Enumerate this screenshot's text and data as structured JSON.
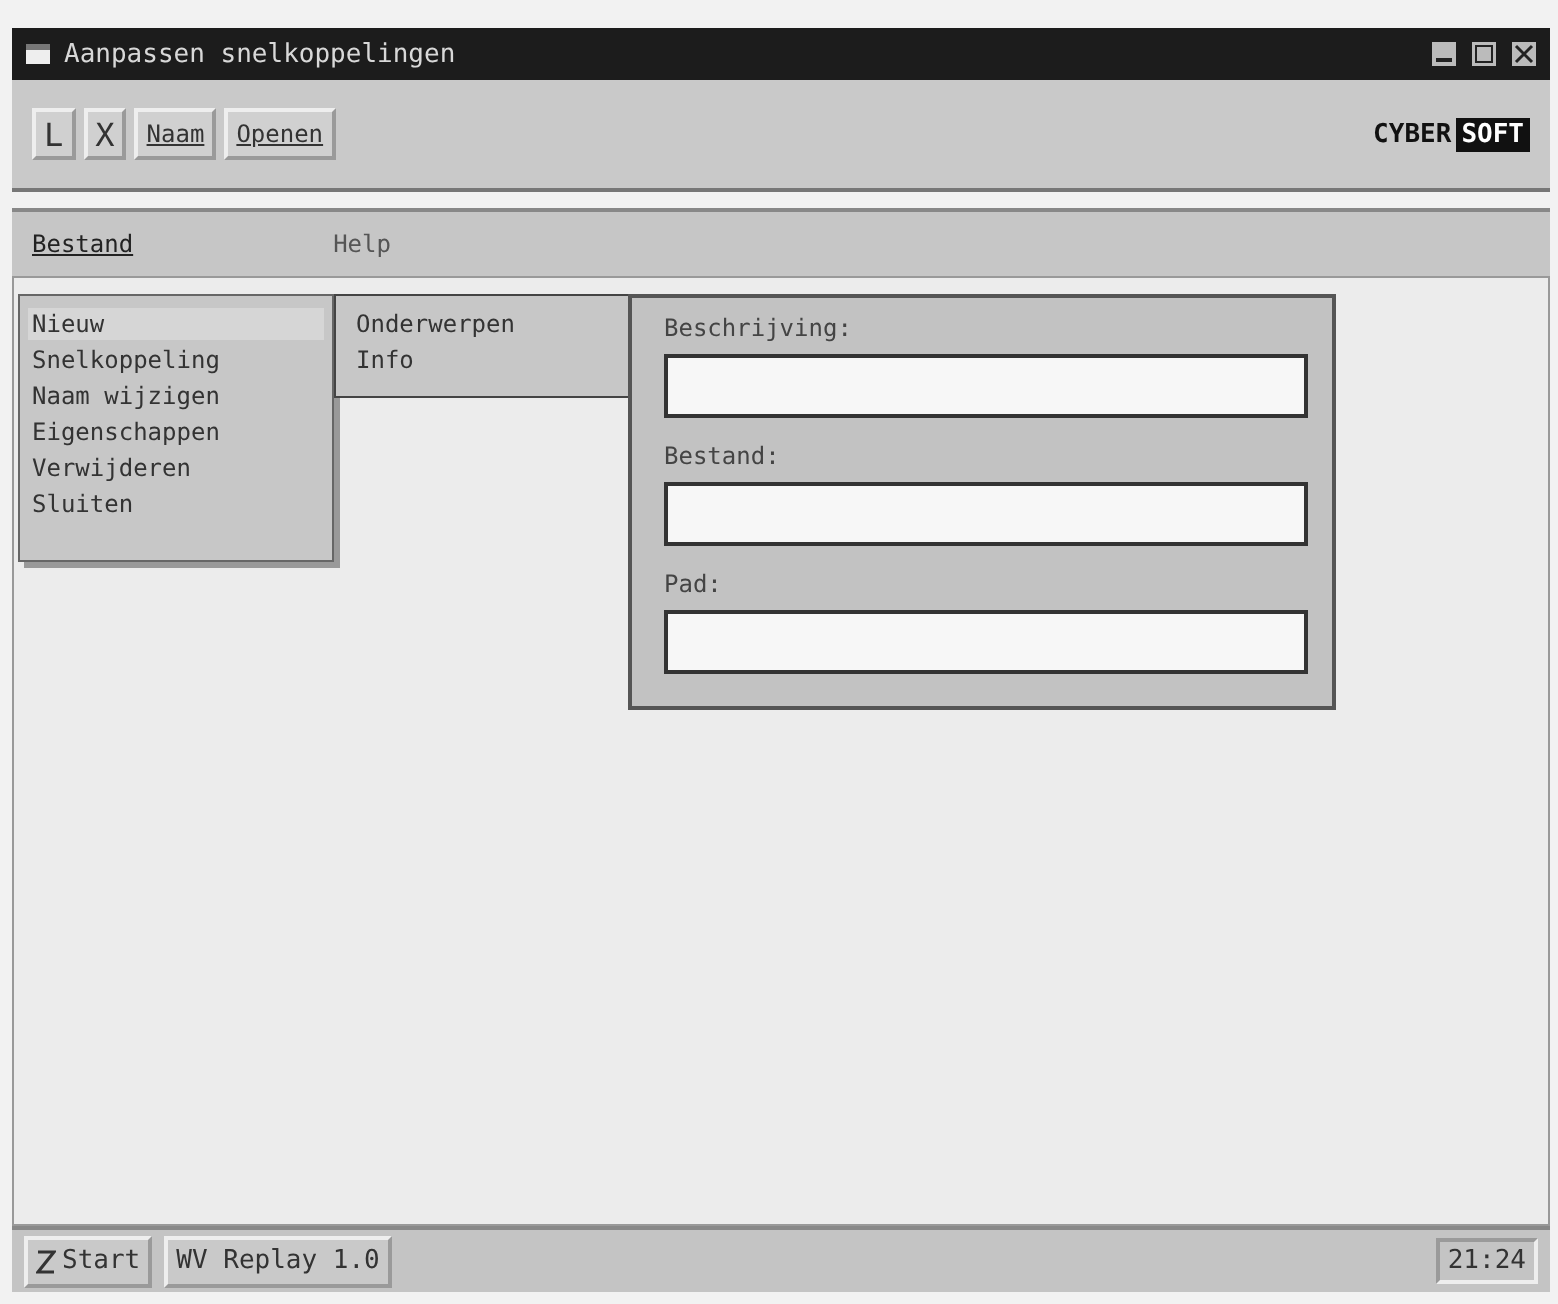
{
  "window": {
    "title": "Aanpassen snelkoppelingen"
  },
  "toolbar": {
    "buttons": [
      {
        "label": "L",
        "kind": "icon"
      },
      {
        "label": "X",
        "kind": "icon"
      },
      {
        "label": "Naam",
        "kind": "text"
      },
      {
        "label": "Openen",
        "kind": "text"
      }
    ],
    "logo": [
      "CYBER",
      "SOFT"
    ]
  },
  "menu_bar": [
    {
      "label": "Bestand",
      "selected": true
    },
    {
      "label": "Help",
      "selected": false
    }
  ],
  "menu": {
    "items": [
      {
        "label": "Nieuw",
        "expanded": true
      },
      {
        "label": "Snelkoppeling",
        "expanded": false
      },
      {
        "label": "Naam wijzigen",
        "expanded": false
      },
      {
        "label": "Eigenschappen",
        "expanded": false
      },
      {
        "label": "Verwijderen",
        "expanded": false
      },
      {
        "label": "Sluiten",
        "expanded": false
      }
    ]
  },
  "submenu": {
    "items": [
      "Onderwerpen",
      "Info"
    ]
  },
  "dialog": {
    "fields": [
      {
        "label": "Beschrijving:"
      },
      {
        "label": "Bestand:"
      },
      {
        "label": "Pad:"
      }
    ]
  },
  "taskbar": {
    "start": "Start",
    "tasks": [
      "WV Replay 1.0"
    ],
    "clock": "21:24"
  }
}
